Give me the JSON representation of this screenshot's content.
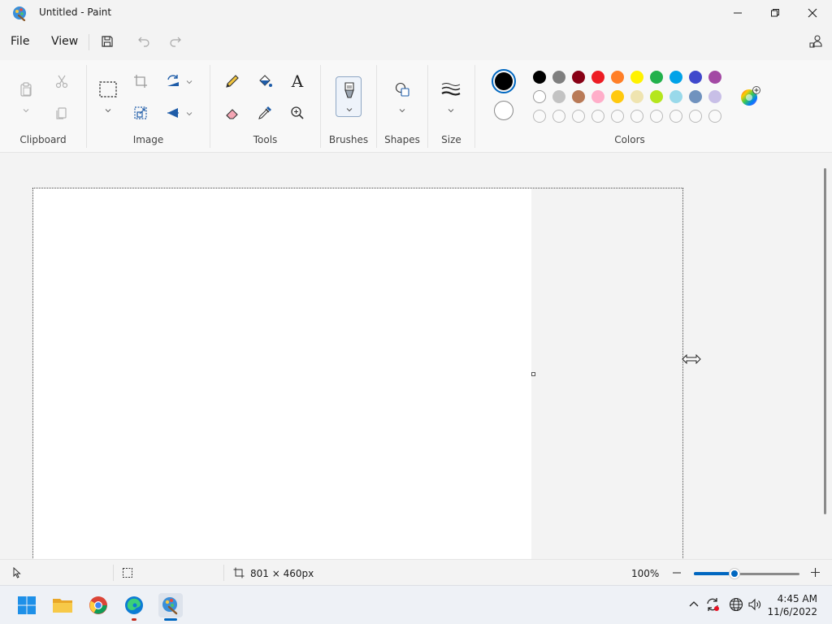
{
  "window": {
    "title": "Untitled - Paint"
  },
  "menu": {
    "file": "File",
    "view": "View"
  },
  "ribbon": {
    "clipboard_label": "Clipboard",
    "image_label": "Image",
    "tools_label": "Tools",
    "brushes_label": "Brushes",
    "shapes_label": "Shapes",
    "size_label": "Size",
    "colors_label": "Colors",
    "text_tool_glyph": "A"
  },
  "colors": {
    "primary": "#000000",
    "secondary": "#ffffff",
    "accent": "#0067c0",
    "palette_row1": [
      "#000000",
      "#7f7f7f",
      "#880015",
      "#ed1c24",
      "#ff7f27",
      "#fff200",
      "#22b14c",
      "#00a2e8",
      "#3f48cc",
      "#a349a4"
    ],
    "palette_row2": [
      "#ffffff",
      "#c3c3c3",
      "#b97a57",
      "#ffaec9",
      "#ffc90e",
      "#efe4b0",
      "#b5e61d",
      "#99d9ea",
      "#7092be",
      "#c8bfe7"
    ],
    "palette_row3_count": 10
  },
  "status": {
    "canvas_size": "801 × 460px",
    "zoom": "100%"
  },
  "taskbar": {
    "time": "4:45 AM",
    "date": "11/6/2022"
  }
}
